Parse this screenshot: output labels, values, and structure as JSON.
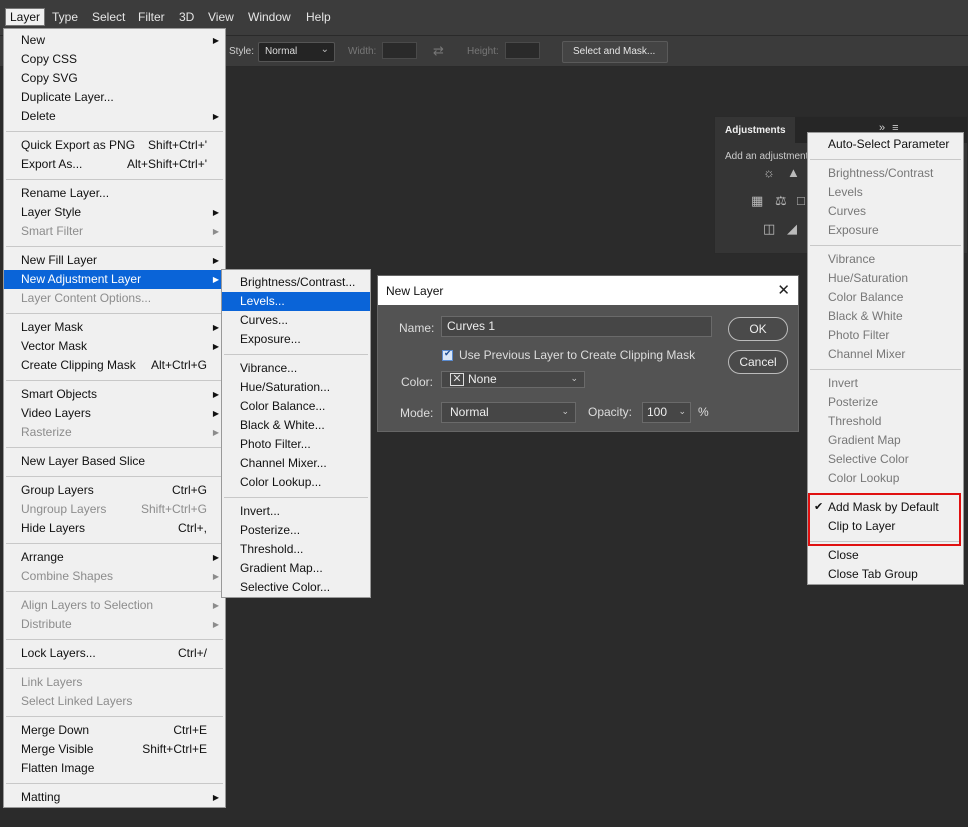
{
  "menubar": {
    "items": [
      "Layer",
      "Type",
      "Select",
      "Filter",
      "3D",
      "View",
      "Window",
      "Help"
    ]
  },
  "options": {
    "style_label": "Style:",
    "style_value": "Normal",
    "width_label": "Width:",
    "height_label": "Height:",
    "select_mask_label": "Select and Mask..."
  },
  "layer_menu": {
    "new": "New",
    "copy_css": "Copy CSS",
    "copy_svg": "Copy SVG",
    "duplicate": "Duplicate Layer...",
    "delete": "Delete",
    "quick_export": "Quick Export as PNG",
    "quick_export_sc": "Shift+Ctrl+'",
    "export_as": "Export As...",
    "export_as_sc": "Alt+Shift+Ctrl+'",
    "rename": "Rename Layer...",
    "layer_style": "Layer Style",
    "smart_filter": "Smart Filter",
    "new_fill": "New Fill Layer",
    "new_adjustment": "New Adjustment Layer",
    "content_options": "Layer Content Options...",
    "layer_mask": "Layer Mask",
    "vector_mask": "Vector Mask",
    "clipping_mask": "Create Clipping Mask",
    "clipping_mask_sc": "Alt+Ctrl+G",
    "smart_objects": "Smart Objects",
    "video_layers": "Video Layers",
    "rasterize": "Rasterize",
    "new_based_slice": "New Layer Based Slice",
    "group_layers": "Group Layers",
    "group_layers_sc": "Ctrl+G",
    "ungroup_layers": "Ungroup Layers",
    "ungroup_layers_sc": "Shift+Ctrl+G",
    "hide_layers": "Hide Layers",
    "hide_layers_sc": "Ctrl+,",
    "arrange": "Arrange",
    "combine_shapes": "Combine Shapes",
    "align_selection": "Align Layers to Selection",
    "distribute": "Distribute",
    "lock_layers": "Lock Layers...",
    "lock_layers_sc": "Ctrl+/",
    "link_layers": "Link Layers",
    "select_linked": "Select Linked Layers",
    "merge_down": "Merge Down",
    "merge_down_sc": "Ctrl+E",
    "merge_visible": "Merge Visible",
    "merge_visible_sc": "Shift+Ctrl+E",
    "flatten": "Flatten Image",
    "matting": "Matting"
  },
  "adj_submenu": {
    "brightness": "Brightness/Contrast...",
    "levels": "Levels...",
    "curves": "Curves...",
    "exposure": "Exposure...",
    "vibrance": "Vibrance...",
    "hue": "Hue/Saturation...",
    "color_balance": "Color Balance...",
    "black_white": "Black & White...",
    "photo_filter": "Photo Filter...",
    "channel_mixer": "Channel Mixer...",
    "color_lookup": "Color Lookup...",
    "invert": "Invert...",
    "posterize": "Posterize...",
    "threshold": "Threshold...",
    "gradient_map": "Gradient Map...",
    "selective_color": "Selective Color..."
  },
  "dialog": {
    "title": "New Layer",
    "name_label": "Name:",
    "name_value": "Curves 1",
    "clip_label": "Use Previous Layer to Create Clipping Mask",
    "color_label": "Color:",
    "color_value": "None",
    "mode_label": "Mode:",
    "mode_value": "Normal",
    "opacity_label": "Opacity:",
    "opacity_value": "100",
    "opacity_unit": "%",
    "ok": "OK",
    "cancel": "Cancel"
  },
  "panel": {
    "tab": "Adjustments",
    "subtitle": "Add an adjustment"
  },
  "panel_menu": {
    "auto_select": "Auto-Select Parameter",
    "brightness": "Brightness/Contrast",
    "levels": "Levels",
    "curves": "Curves",
    "exposure": "Exposure",
    "vibrance": "Vibrance",
    "hue": "Hue/Saturation",
    "color_balance": "Color Balance",
    "black_white": "Black & White",
    "photo_filter": "Photo Filter",
    "channel_mixer": "Channel Mixer",
    "invert": "Invert",
    "posterize": "Posterize",
    "threshold": "Threshold",
    "gradient_map": "Gradient Map",
    "selective_color": "Selective Color",
    "color_lookup": "Color Lookup",
    "add_mask": "Add Mask by Default",
    "clip_to_layer": "Clip to Layer",
    "close": "Close",
    "close_tab_group": "Close Tab Group"
  },
  "colors": {
    "highlight": "#0a64d8",
    "annotation_box": "#e01010"
  }
}
